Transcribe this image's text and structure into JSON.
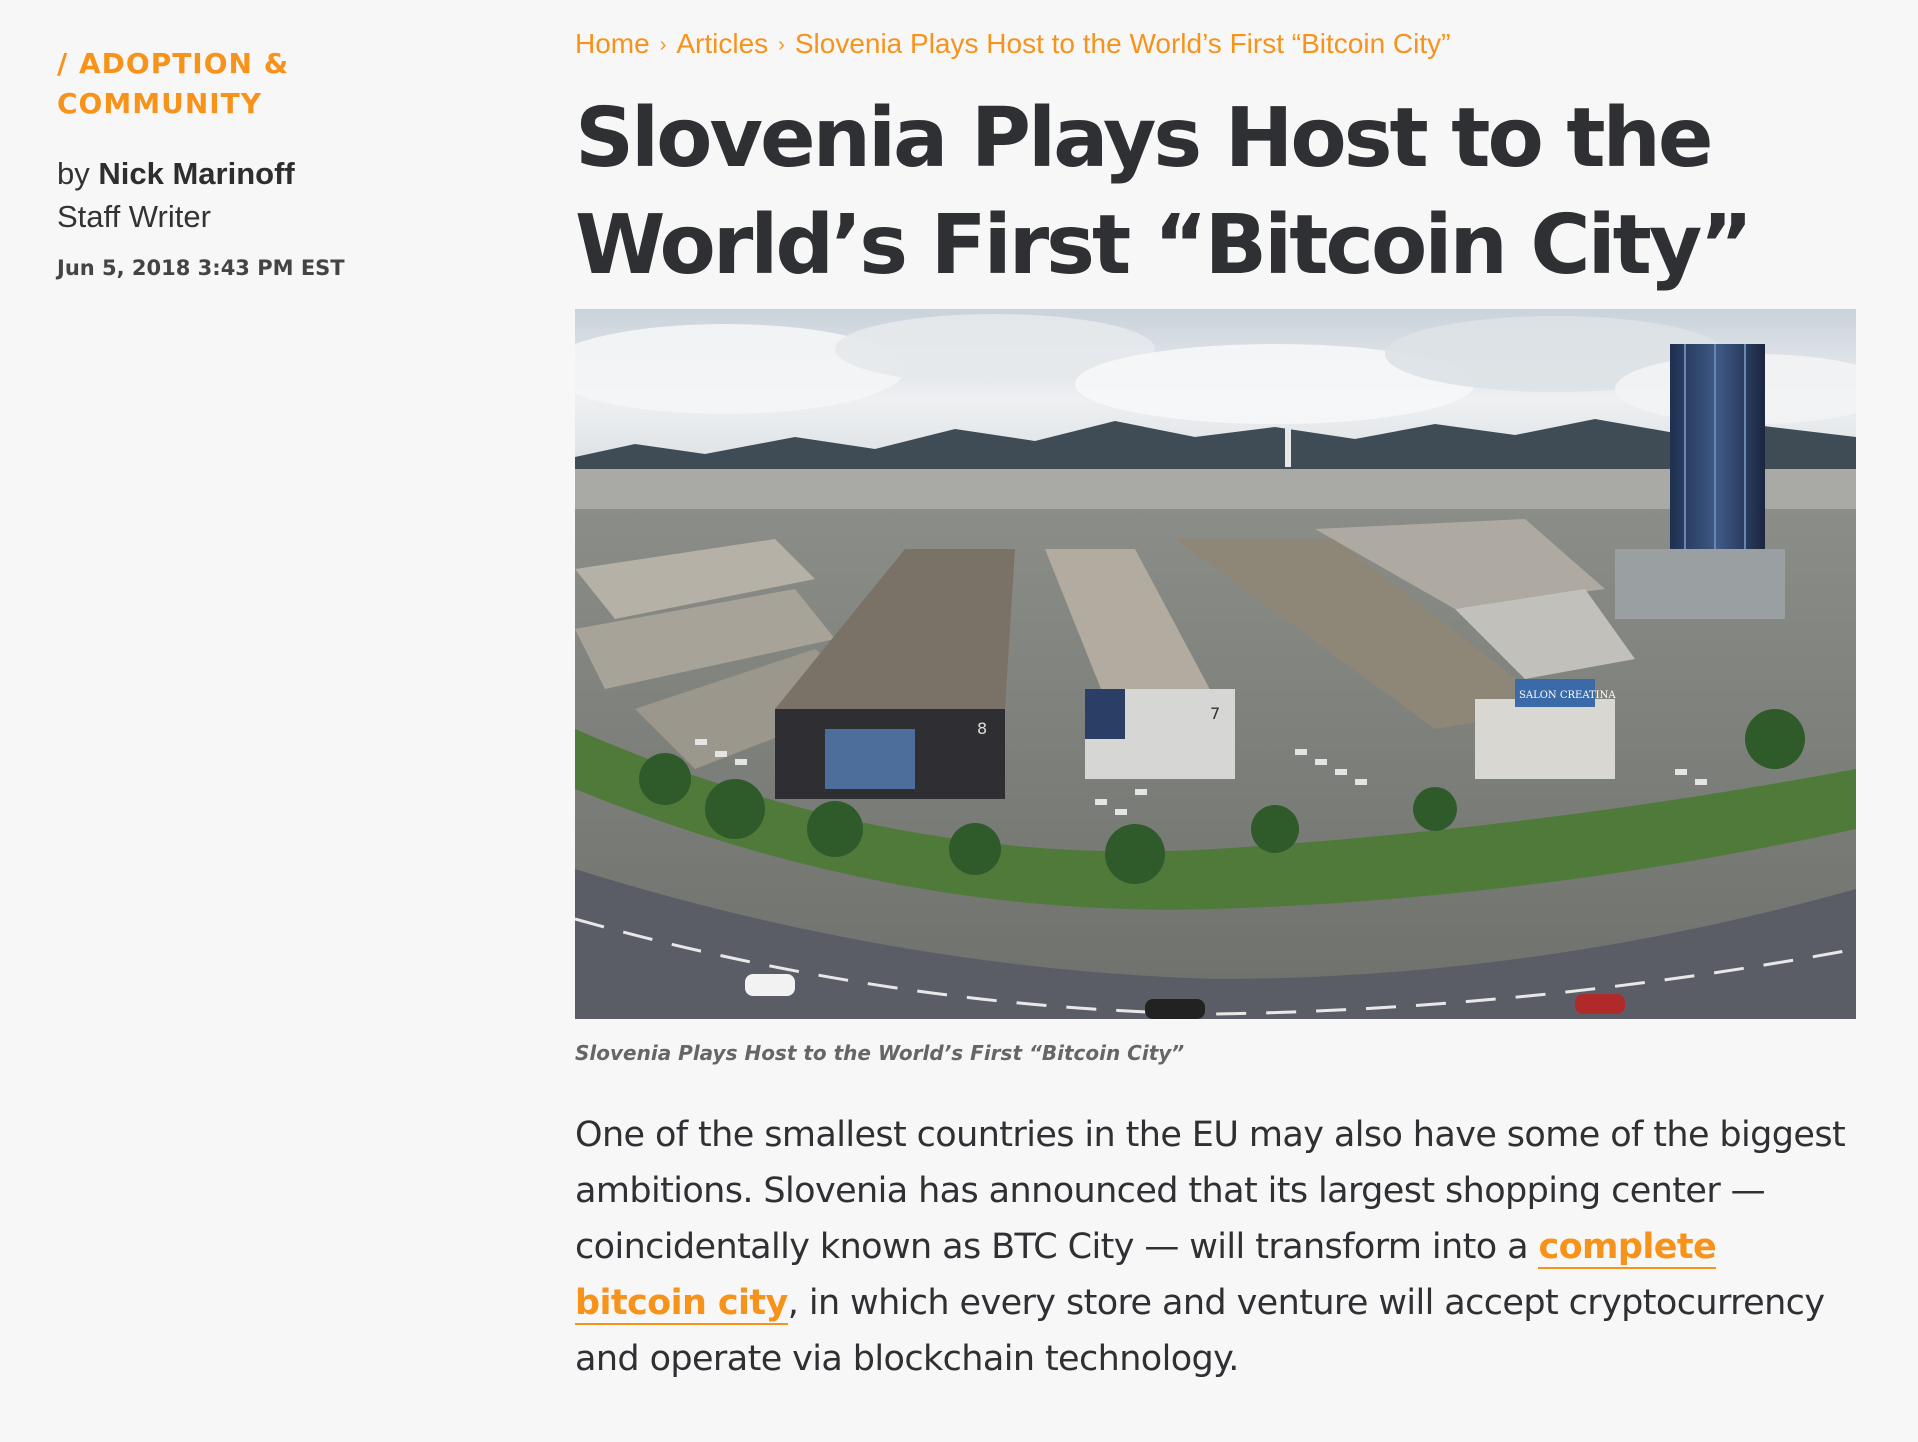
{
  "sidebar": {
    "category": "/ ADOPTION & COMMUNITY",
    "by_prefix": "by",
    "author": "Nick Marinoff",
    "role": "Staff Writer",
    "date": "Jun 5, 2018 3:43 PM EST"
  },
  "breadcrumb": {
    "items": [
      "Home",
      "Articles",
      "Slovenia Plays Host to the World’s First “Bitcoin City”"
    ],
    "separator": "›"
  },
  "article": {
    "title": "Slovenia Plays Host to the World’s First “Bitcoin City”",
    "image_caption": "Slovenia Plays Host to the World’s First “Bitcoin City”",
    "image_sign": "SALON CREATINA",
    "building_numbers": [
      "8",
      "7"
    ],
    "paragraph": {
      "before_link": "One of the smallest countries in the EU may also have some of the biggest ambitions. Slovenia has announced that its largest shopping center — coincidentally known as BTC City — will transform into a ",
      "link_text": "complete bitcoin city",
      "after_link": ", in which every store and venture will accept cryptocurrency and operate via blockchain technology."
    }
  },
  "colors": {
    "accent": "#f7931a",
    "text": "#2f3033",
    "background": "#f7f7f7"
  }
}
